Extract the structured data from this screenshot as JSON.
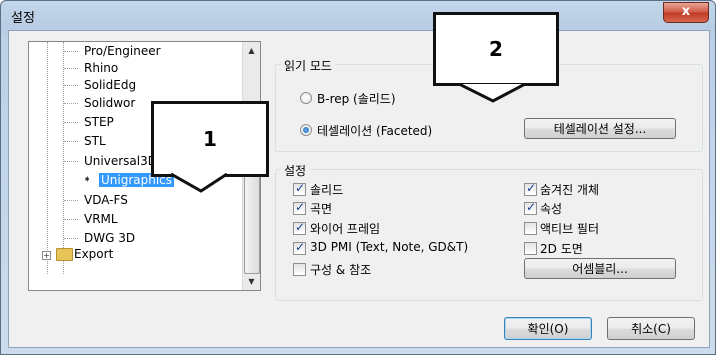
{
  "window": {
    "title": "설정",
    "close_glyph": "x"
  },
  "tree": {
    "items": [
      {
        "label": "Pro/Engineer"
      },
      {
        "label": "Rhino"
      },
      {
        "label": "SolidEdg"
      },
      {
        "label": "Solidwor"
      },
      {
        "label": "STEP"
      },
      {
        "label": "STL"
      },
      {
        "label": "Universal3D"
      },
      {
        "label": "Unigraphics",
        "selected": true
      },
      {
        "label": "VDA-FS"
      },
      {
        "label": "VRML"
      },
      {
        "label": "DWG 3D"
      }
    ],
    "export_label": "Export",
    "expand_glyph": "+",
    "selected_arrow": "➧"
  },
  "read_mode": {
    "title": "읽기 모드",
    "options": [
      {
        "label": "B-rep (솔리드)",
        "checked": false
      },
      {
        "label": "테셀레이션 (Faceted)",
        "checked": true
      }
    ],
    "tess_button": "테셀레이션 설정..."
  },
  "settings": {
    "title": "설정",
    "left": [
      {
        "label": "솔리드",
        "checked": true
      },
      {
        "label": "곡면",
        "checked": true
      },
      {
        "label": "와이어 프레임",
        "checked": true
      },
      {
        "label": "3D PMI (Text, Note, GD&T)",
        "checked": true
      },
      {
        "label": "구성 & 참조",
        "checked": false
      }
    ],
    "right": [
      {
        "label": "숨겨진 개체",
        "checked": true
      },
      {
        "label": "속성",
        "checked": true
      },
      {
        "label": "액티브 필터",
        "checked": false
      },
      {
        "label": "2D 도면",
        "checked": false
      }
    ],
    "assembly_button": "어셈블리..."
  },
  "footer": {
    "ok": "확인(O)",
    "cancel": "취소(C)"
  },
  "callouts": {
    "one": "1",
    "two": "2"
  },
  "colors": {
    "selection": "#3399ff",
    "frame": "#b9cde4"
  }
}
